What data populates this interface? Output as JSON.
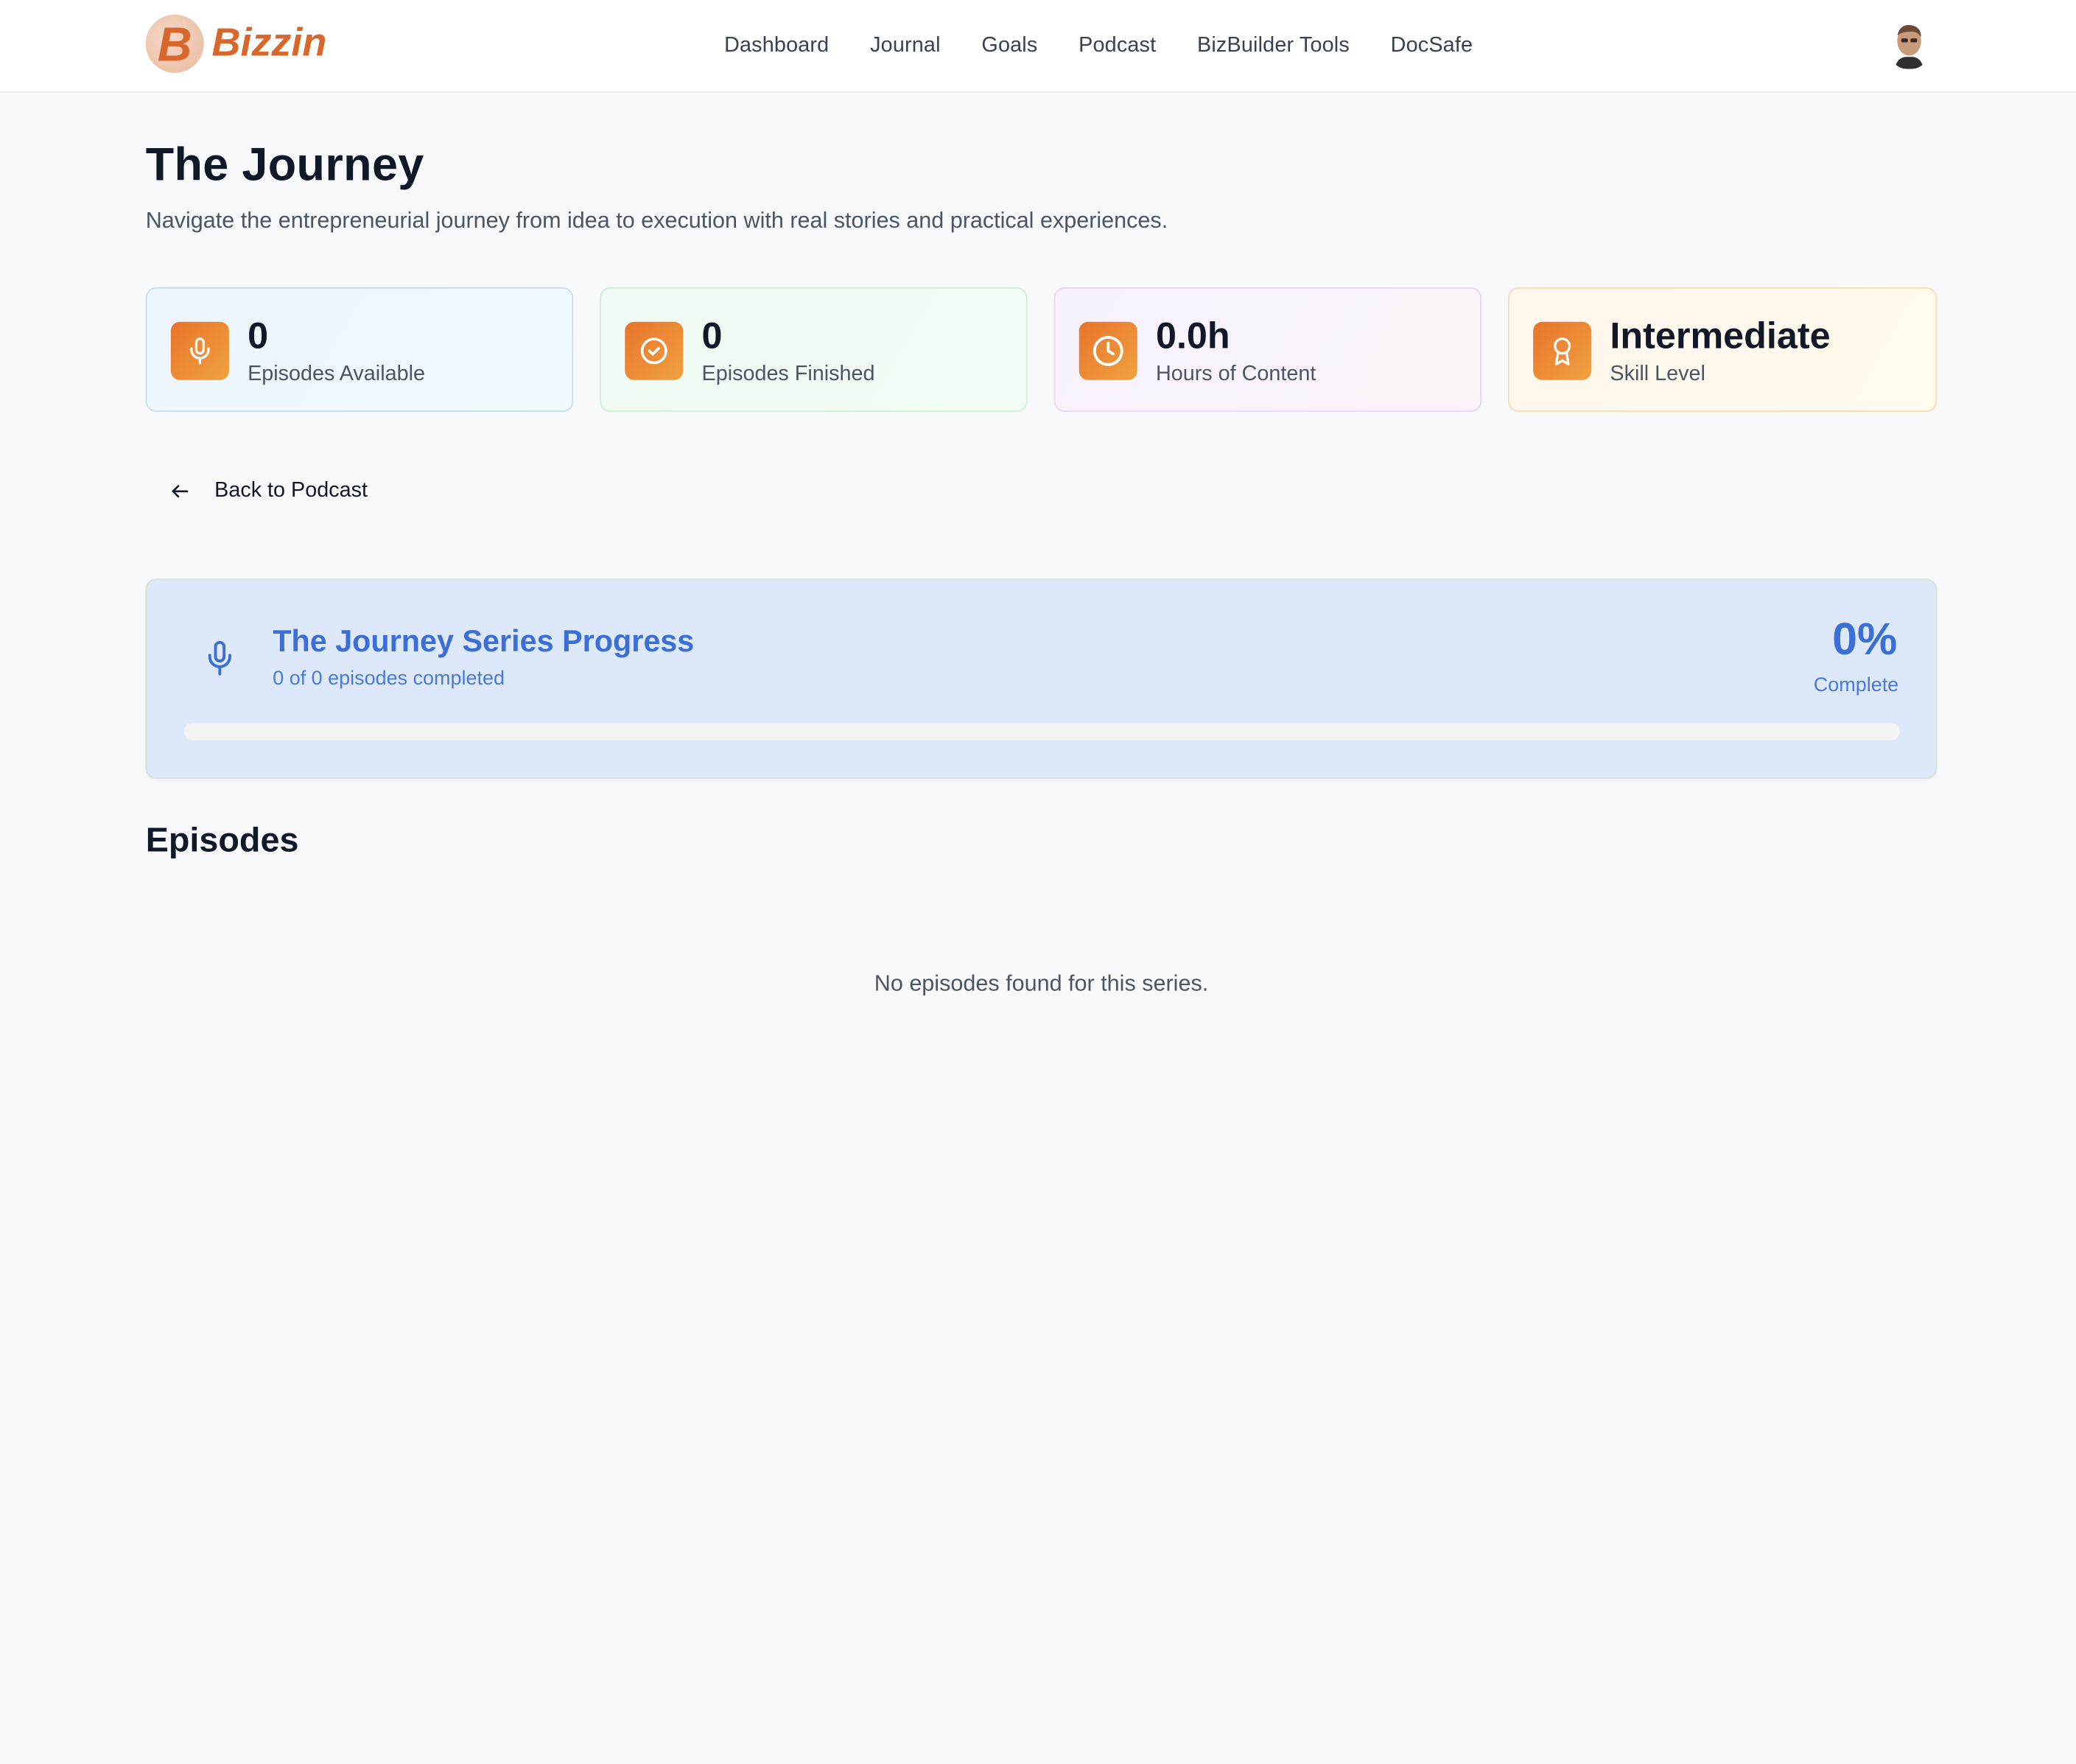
{
  "brand": {
    "name": "Bizzin",
    "mark": "B"
  },
  "nav": [
    {
      "label": "Dashboard"
    },
    {
      "label": "Journal"
    },
    {
      "label": "Goals"
    },
    {
      "label": "Podcast"
    },
    {
      "label": "BizBuilder Tools"
    },
    {
      "label": "DocSafe"
    }
  ],
  "page": {
    "title": "The Journey",
    "subtitle": "Navigate the entrepreneurial journey from idea to execution with real stories and practical experiences."
  },
  "stats": [
    {
      "value": "0",
      "label": "Episodes Available",
      "icon": "microphone-icon"
    },
    {
      "value": "0",
      "label": "Episodes Finished",
      "icon": "check-circle-icon"
    },
    {
      "value": "0.0h",
      "label": "Hours of Content",
      "icon": "clock-icon"
    },
    {
      "value": "Intermediate",
      "label": "Skill Level",
      "icon": "award-icon"
    }
  ],
  "back": {
    "label": "Back to Podcast"
  },
  "progress": {
    "title": "The Journey Series Progress",
    "subtitle": "0 of 0 episodes completed",
    "percent_label": "0%",
    "complete_label": "Complete",
    "fraction": 0
  },
  "episodes": {
    "heading": "Episodes",
    "empty_message": "No episodes found for this series."
  },
  "colors": {
    "accent_orange": "#e8742b",
    "progress_blue": "#3b6fd8",
    "brand": "#d9662b"
  }
}
